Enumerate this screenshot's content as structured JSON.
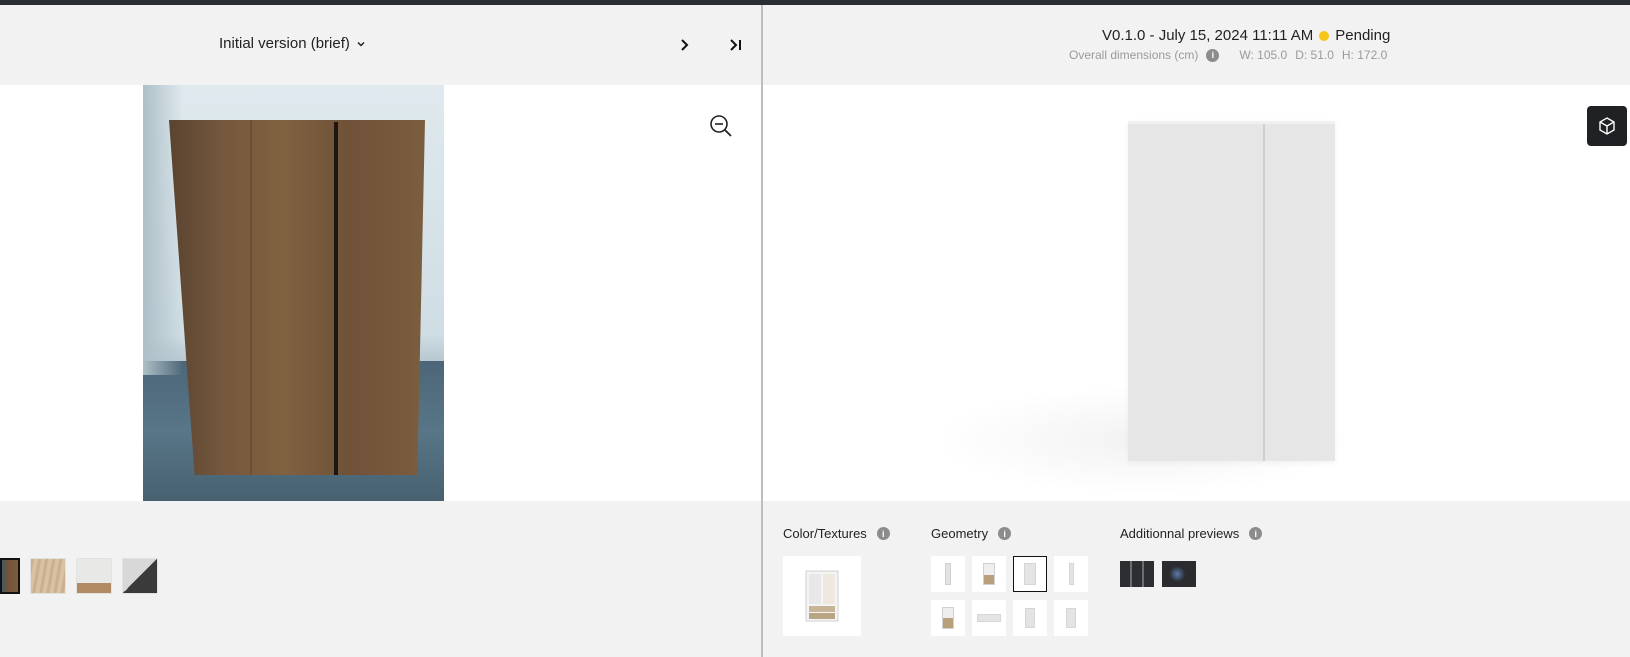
{
  "left": {
    "version_label": "Initial version (brief)",
    "next_icon": "chevron-right-icon",
    "last_icon": "skip-to-last-icon",
    "zoom_icon": "zoom-out-icon",
    "thumbnails": [
      "cardboard-box-photo",
      "wood-texture",
      "room-photo",
      "interior-photo"
    ]
  },
  "right": {
    "version": "V0.1.0 - July 15, 2024 11:11 AM",
    "status": "Pending",
    "status_color": "#f5c518",
    "dims_label": "Overall dimensions (cm)",
    "dims": {
      "w": "W: 105.0",
      "d": "D: 51.0",
      "h": "H: 172.0"
    },
    "view_3d_icon": "cube-icon",
    "sections": {
      "color_textures": "Color/Textures",
      "geometry": "Geometry",
      "additional_previews": "Additionnal previews"
    },
    "geometry_selected_index": 2
  }
}
